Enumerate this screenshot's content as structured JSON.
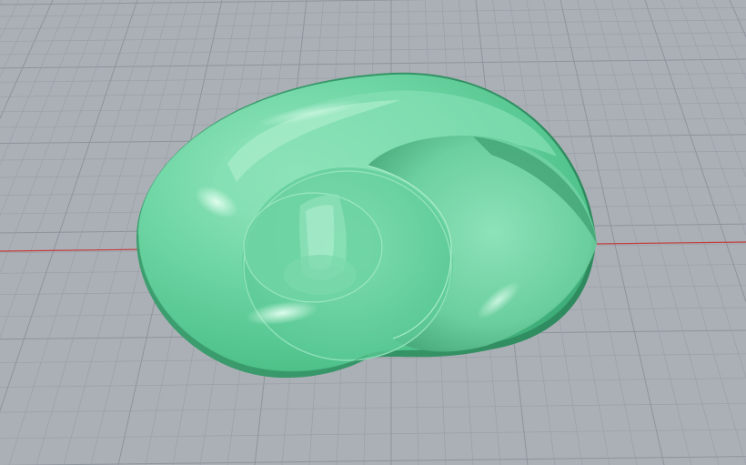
{
  "viewport": {
    "background_color": "#abb0b6",
    "grid_minor_color": "#9aa0a7",
    "grid_major_color": "#8e949b",
    "x_axis_color": "#c23a3a",
    "model": {
      "name": "shell-surface",
      "color": "#5fcf98",
      "highlight_color": "#c8f5dd",
      "shadow_color": "#2f9e6a"
    }
  }
}
